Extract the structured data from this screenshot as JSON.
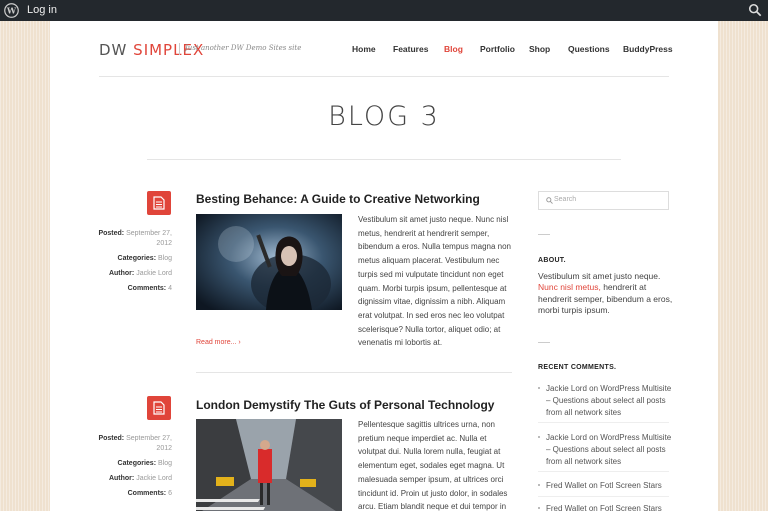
{
  "adminbar": {
    "login": "Log in",
    "wp_icon": "wordpress-logo-icon",
    "search_icon": "search-icon"
  },
  "site": {
    "logo_part1": "DW",
    "logo_part2": "SIMPLEX",
    "tagline": "Just another DW Demo Sites site"
  },
  "nav": [
    "Home",
    "Features",
    "Blog",
    "Portfolio",
    "Shop",
    "Questions",
    "BuddyPress"
  ],
  "nav_active": "Blog",
  "page_title": "BLOG 3",
  "posts": [
    {
      "title": "Besting Behance: A Guide to Creative Networking",
      "posted_label": "Posted:",
      "posted_value_1": "September 27,",
      "posted_value_2": "2012",
      "categories_label": "Categories:",
      "categories_value": "Blog",
      "author_label": "Author:",
      "author_value": "Jackie Lord",
      "comments_label": "Comments:",
      "comments_value": "4",
      "excerpt": "Vestibulum sit amet justo neque. Nunc nisl metus, hendrerit at hendrerit semper, bibendum a eros. Nulla tempus magna non metus aliquam placerat. Vestibulum nec turpis sed mi vulputate tincidunt non eget quam. Morbi turpis ipsum, pellentesque at dignissim vitae, dignissim a nibh. Aliquam erat volutpat. In sed eros nec leo volutpat scelerisque? Nulla tortor, aliquet odio; at venenatis mi lobortis at.",
      "read_more": "Read more... ›"
    },
    {
      "title": "London Demystify The Guts of Personal Technology",
      "posted_label": "Posted:",
      "posted_value_1": "September 27,",
      "posted_value_2": "2012",
      "categories_label": "Categories:",
      "categories_value": "Blog",
      "author_label": "Author:",
      "author_value": "Jackie Lord",
      "comments_label": "Comments:",
      "comments_value": "6",
      "excerpt": "Pellentesque sagittis ultrices urna, non pretium neque imperdiet ac. Nulla et volutpat dui. Nulla lorem nulla, feugiat at elementum eget, sodales eget magna. Ut malesuada semper ipsum, at ultrices orci tincidunt id. Proin ut justo dolor, in sodales arcu. Etiam blandit neque et dui tempor in condimentum orci consectetur."
    }
  ],
  "sidebar": {
    "search_placeholder": "Search",
    "about_title": "ABOUT.",
    "about_text_1": "Vestibulum sit amet justo neque.",
    "about_link": "Nunc nisl metus,",
    "about_text_2": " hendrerit at hendrerit semper, bibendum a eros, morbi turpis ipsum.",
    "recent_title": "RECENT COMMENTS.",
    "recent": [
      "Jackie Lord on WordPress Multisite – Questions about select all posts from all network sites",
      "Jackie Lord on WordPress Multisite – Questions about select all posts from all network sites",
      "Fred Wallet on Fotl Screen Stars",
      "Fred Wallet on Fotl Screen Stars"
    ]
  },
  "colors": {
    "accent": "#e0453a",
    "adminbar": "#23282d",
    "background": "#efe1cf"
  }
}
